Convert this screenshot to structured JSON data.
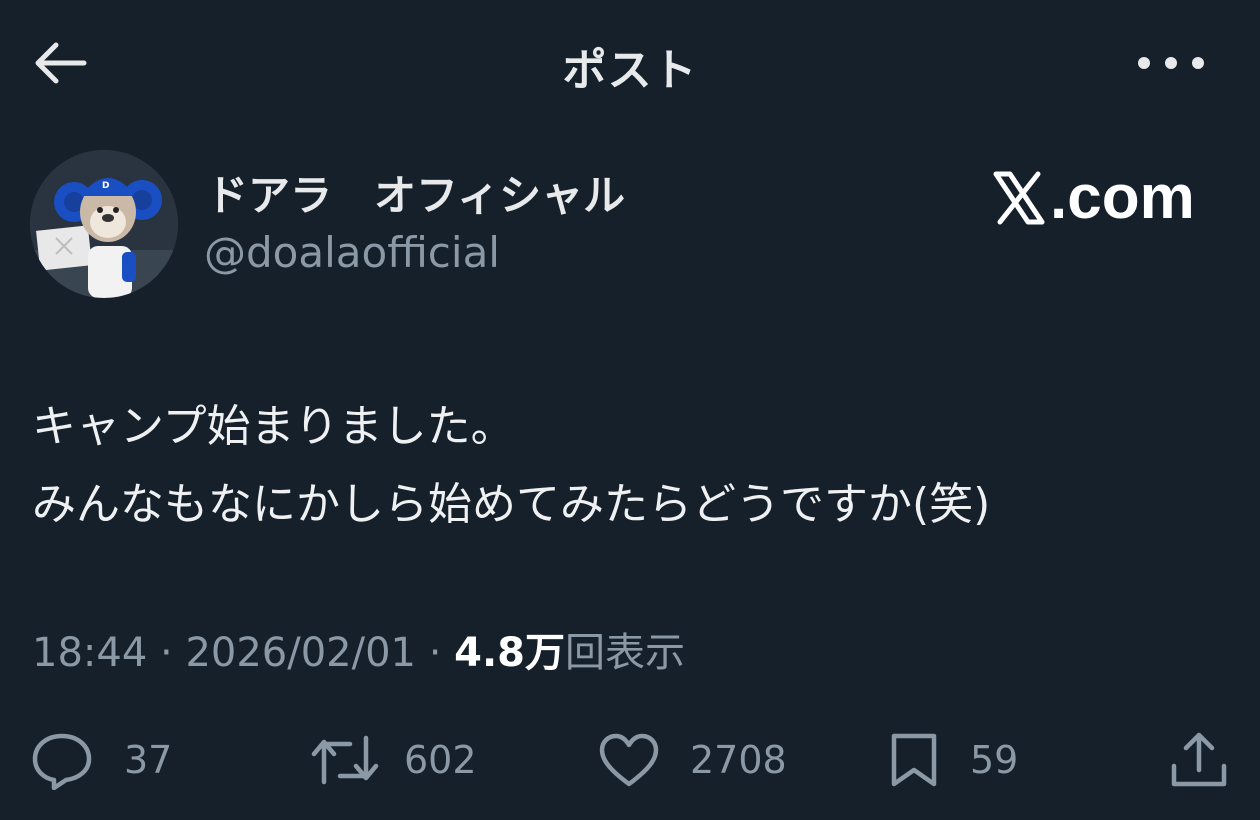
{
  "header": {
    "title": "ポスト",
    "back_icon": "arrow-left-icon",
    "more_icon": "more-horizontal-icon"
  },
  "author": {
    "display_name": "ドアラ　オフィシャル",
    "handle": "@doalaofficial"
  },
  "watermark": {
    "text": ".com",
    "logo": "x-logo"
  },
  "post": {
    "lines": [
      "キャンプ始まりました。",
      "みんなもなにかしら始めてみたらどうですか(笑)"
    ]
  },
  "meta": {
    "time": "18:44",
    "separator": "·",
    "date": "2026/02/01",
    "views_count": "4.8万",
    "views_label": "回表示"
  },
  "actions": {
    "replies": "37",
    "reposts": "602",
    "likes": "2708",
    "bookmarks": "59"
  },
  "colors": {
    "background": "#15202b",
    "text": "#e7e9ea",
    "muted": "#8b98a5",
    "team_blue": "#1a4fc4"
  }
}
